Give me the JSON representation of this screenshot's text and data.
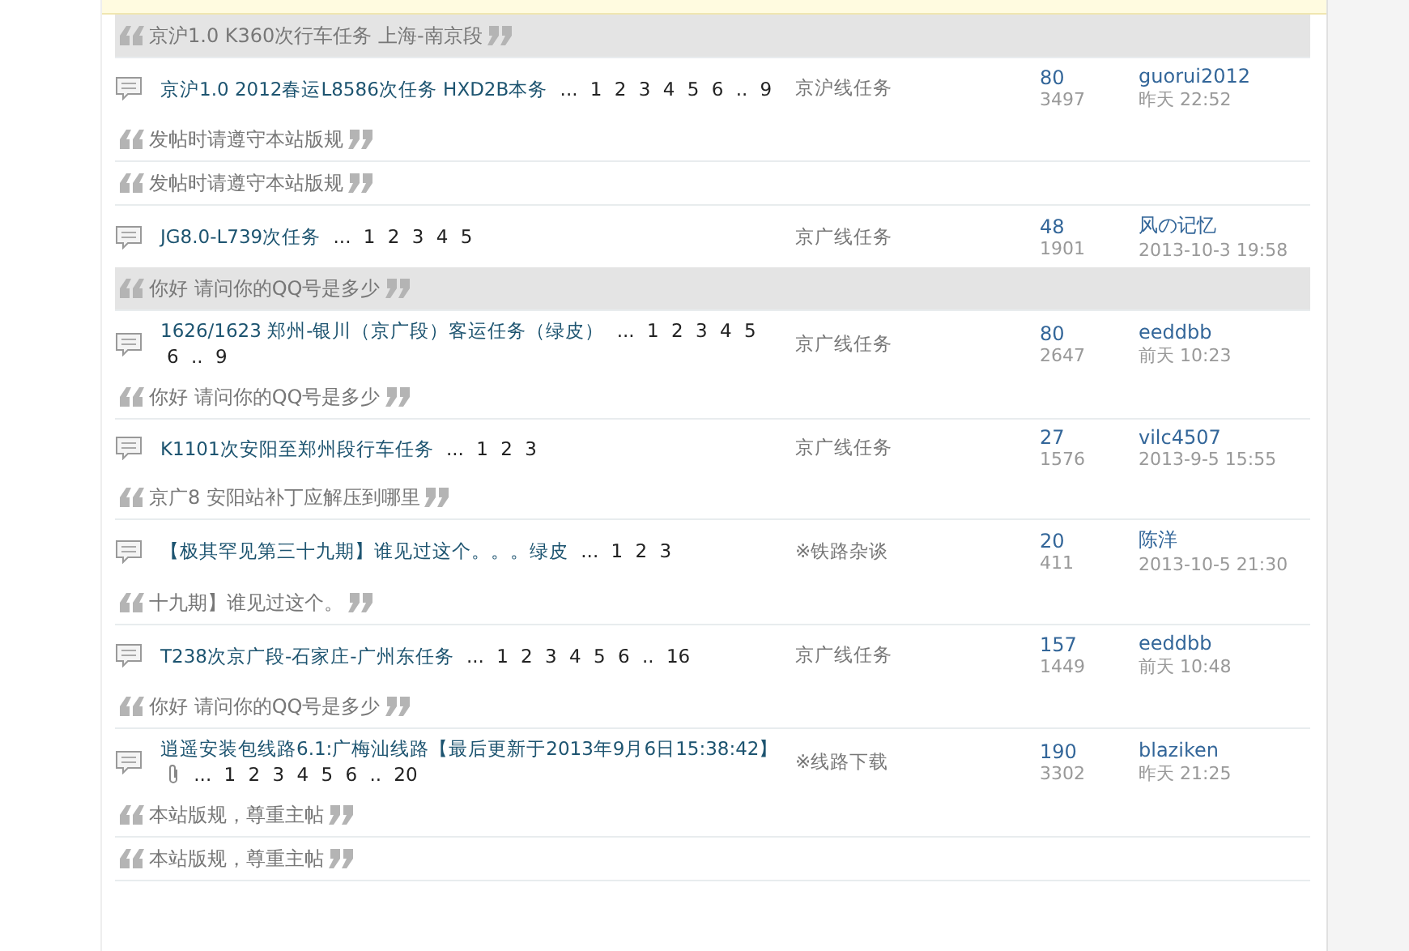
{
  "items": [
    {
      "kind": "quote",
      "text": "京沪1.0 K360次行车任务 上海-南京段",
      "shaded": true
    },
    {
      "kind": "thread",
      "title": "京沪1.0 2012春运L8586次任务 HXD2B本务",
      "attachment": false,
      "pager": [
        "...",
        "1",
        "2",
        "3",
        "4",
        "5",
        "6",
        "..",
        "9"
      ],
      "forum": "京沪线任务",
      "replies": "80",
      "views": "3497",
      "author": "guorui2012",
      "time": "昨天 22:52"
    },
    {
      "kind": "quote",
      "text": "发帖时请遵守本站版规",
      "shaded": false
    },
    {
      "kind": "quote",
      "text": "发帖时请遵守本站版规",
      "shaded": false
    },
    {
      "kind": "thread",
      "title": "JG8.0-L739次任务",
      "attachment": false,
      "pager": [
        "...",
        "1",
        "2",
        "3",
        "4",
        "5"
      ],
      "forum": "京广线任务",
      "replies": "48",
      "views": "1901",
      "author": "风の记忆",
      "time": "2013-10-3 19:58"
    },
    {
      "kind": "quote",
      "text": "你好 请问你的QQ号是多少",
      "shaded": true
    },
    {
      "kind": "thread",
      "title": "1626/1623 郑州-银川（京广段）客运任务（绿皮）",
      "attachment": false,
      "pager": [
        "...",
        "1",
        "2",
        "3",
        "4",
        "5",
        "6",
        "..",
        "9"
      ],
      "forum": "京广线任务",
      "replies": "80",
      "views": "2647",
      "author": "eeddbb",
      "time": "前天 10:23"
    },
    {
      "kind": "quote",
      "text": "你好 请问你的QQ号是多少",
      "shaded": false
    },
    {
      "kind": "thread",
      "title": "K1101次安阳至郑州段行车任务",
      "attachment": false,
      "pager": [
        "...",
        "1",
        "2",
        "3"
      ],
      "forum": "京广线任务",
      "replies": "27",
      "views": "1576",
      "author": "vilc4507",
      "time": "2013-9-5 15:55"
    },
    {
      "kind": "quote",
      "text": "京广8 安阳站补丁应解压到哪里",
      "shaded": false
    },
    {
      "kind": "thread",
      "title": "【极其罕见第三十九期】谁见过这个。。。绿皮",
      "attachment": false,
      "pager": [
        "...",
        "1",
        "2",
        "3"
      ],
      "forum": "※铁路杂谈",
      "replies": "20",
      "views": "411",
      "author": "陈洋",
      "time": "2013-10-5 21:30"
    },
    {
      "kind": "quote",
      "text": "十九期】谁见过这个。",
      "shaded": false
    },
    {
      "kind": "thread",
      "title": "T238次京广段-石家庄-广州东任务",
      "attachment": false,
      "pager": [
        "...",
        "1",
        "2",
        "3",
        "4",
        "5",
        "6",
        "..",
        "16"
      ],
      "forum": "京广线任务",
      "replies": "157",
      "views": "1449",
      "author": "eeddbb",
      "time": "前天 10:48"
    },
    {
      "kind": "quote",
      "text": "你好 请问你的QQ号是多少",
      "shaded": false
    },
    {
      "kind": "thread",
      "title": "逍遥安装包线路6.1:广梅汕线路【最后更新于2013年9月6日15:38:42】",
      "attachment": true,
      "pager": [
        "...",
        "1",
        "2",
        "3",
        "4",
        "5",
        "6",
        "..",
        "20"
      ],
      "forum": "※线路下载",
      "replies": "190",
      "views": "3302",
      "author": "blaziken",
      "time": "昨天 21:25"
    },
    {
      "kind": "quote",
      "text": "本站版规，尊重主帖",
      "shaded": false
    },
    {
      "kind": "quote",
      "text": "本站版规，尊重主帖",
      "shaded": false
    }
  ]
}
